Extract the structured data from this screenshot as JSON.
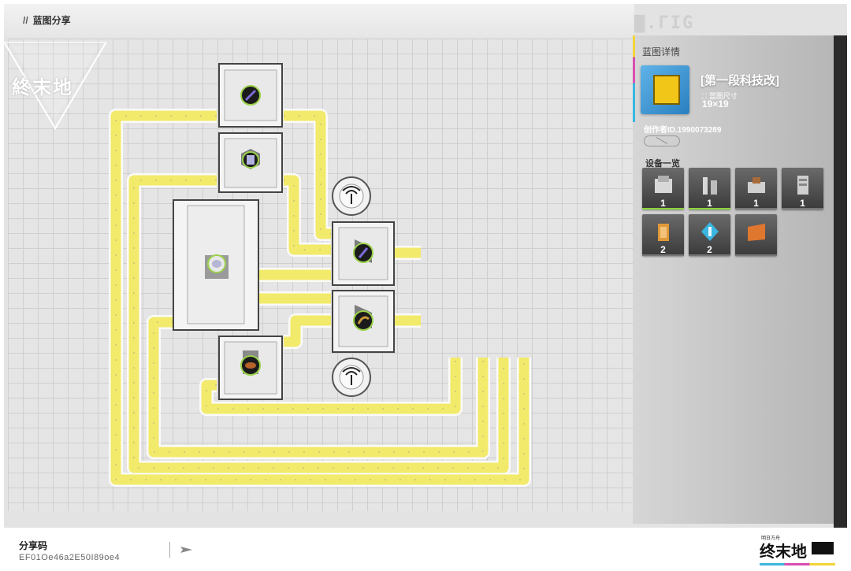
{
  "header": {
    "title": "蓝图分享"
  },
  "panel": {
    "section_title": "蓝图详情",
    "blueprint_name": "第一段科技改",
    "size_label": "蓝图尺寸",
    "size_value": "19×19",
    "author": "创作者ID.1990073289",
    "devices_title": "设备一览",
    "devices": [
      {
        "count": "1",
        "color": "#8bd43a"
      },
      {
        "count": "1",
        "color": "#8bd43a"
      },
      {
        "count": "1",
        "color": "#777777"
      },
      {
        "count": "1",
        "color": "#777777"
      },
      {
        "count": "2",
        "color": "#777777"
      },
      {
        "count": "2",
        "color": "#777777"
      },
      {
        "count": "",
        "color": "#777777"
      }
    ]
  },
  "footer": {
    "share_label": "分享码",
    "share_code": "EF01Oe46a2E50I89oe4"
  },
  "logo": {
    "top_left": "終末地",
    "bottom_right": "终末地",
    "bottom_right_small": "明日方舟"
  },
  "colors": {
    "belt": "#f2ea6a",
    "belt_border": "#ffffff",
    "grid": "#cfcfcf",
    "background": "#e3e3e3",
    "accent_yellow": "#f2d43a",
    "accent_pink": "#d94fb0",
    "accent_blue": "#3ab6e0"
  }
}
